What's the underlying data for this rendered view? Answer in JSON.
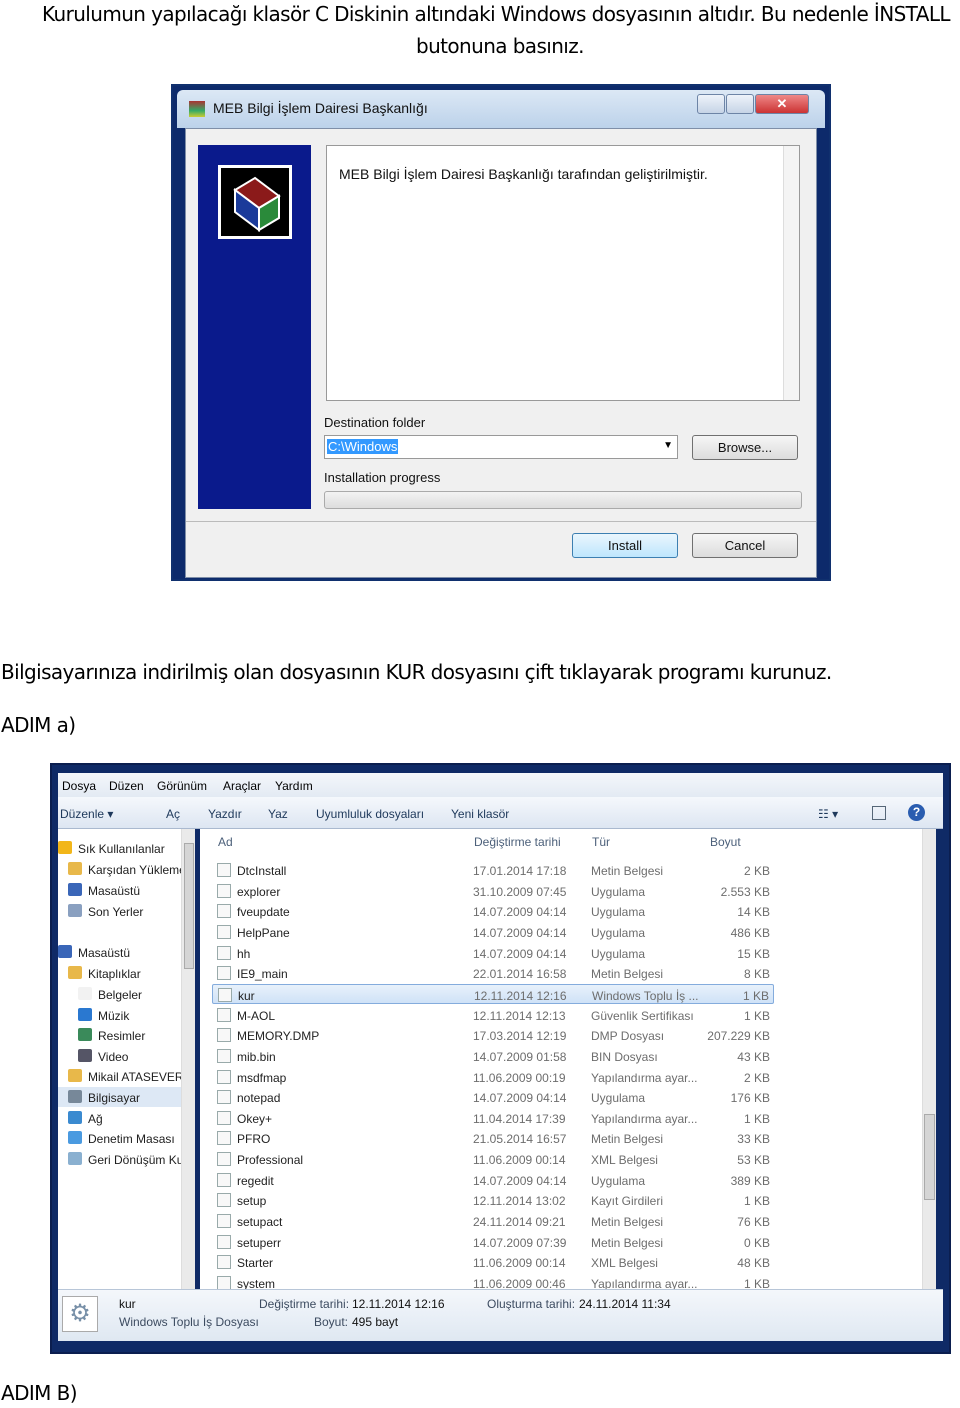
{
  "doc": {
    "intro_line1": "Kurulumun yapılacağı klasör C Diskinin altındaki Windows dosyasının altıdır. Bu nedenle İNSTALL",
    "intro_line2": "butonuna basınız.",
    "instruction": "Bilgisayarınıza indirilmiş olan dosyasının KUR dosyasını çift tıklayarak programı kurunuz.",
    "step_a": "ADIM a)",
    "step_b": "ADIM B)"
  },
  "installer": {
    "title": "MEB Bilgi İşlem Dairesi Başkanlığı",
    "message": "MEB Bilgi İşlem Dairesi Başkanlığı tarafından geliştirilmiştir.",
    "destination_label": "Destination folder",
    "destination_value": "C:\\Windows",
    "browse_label": "Browse...",
    "progress_label": "Installation progress",
    "progress": 0,
    "install_label": "Install",
    "cancel_label": "Cancel"
  },
  "explorer": {
    "menu": [
      "Dosya",
      "Düzen",
      "Görünüm",
      "Araçlar",
      "Yardım"
    ],
    "toolbar": [
      "Düzenle ▾",
      "Aç",
      "Yazdır",
      "Yaz",
      "Uyumluluk dosyaları",
      "Yeni klasör"
    ],
    "sidebar": [
      "Sık Kullanılanlar",
      "Karşıdan Yüklemeler",
      "Masaüstü",
      "Son Yerler",
      "Masaüstü",
      "Kitaplıklar",
      "Belgeler",
      "Müzik",
      "Resimler",
      "Video",
      "Mikail ATASEVER",
      "Bilgisayar",
      "Ağ",
      "Denetim Masası",
      "Geri Dönüşüm Kutusu"
    ],
    "selected_sidebar": "Bilgisayar",
    "columns": [
      "Ad",
      "Değiştirme tarihi",
      "Tür",
      "Boyut"
    ],
    "rows": [
      [
        "DtcInstall",
        "17.01.2014 17:18",
        "Metin Belgesi",
        "2 KB"
      ],
      [
        "explorer",
        "31.10.2009 07:45",
        "Uygulama",
        "2.553 KB"
      ],
      [
        "fveupdate",
        "14.07.2009 04:14",
        "Uygulama",
        "14 KB"
      ],
      [
        "HelpPane",
        "14.07.2009 04:14",
        "Uygulama",
        "486 KB"
      ],
      [
        "hh",
        "14.07.2009 04:14",
        "Uygulama",
        "15 KB"
      ],
      [
        "IE9_main",
        "22.01.2014 16:58",
        "Metin Belgesi",
        "8 KB"
      ],
      [
        "kur",
        "12.11.2014 12:16",
        "Windows Toplu İş ...",
        "1 KB"
      ],
      [
        "M-AOL",
        "12.11.2014 12:13",
        "Güvenlik Sertifikası",
        "1 KB"
      ],
      [
        "MEMORY.DMP",
        "17.03.2014 12:19",
        "DMP Dosyası",
        "207.229 KB"
      ],
      [
        "mib.bin",
        "14.07.2009 01:58",
        "BIN Dosyası",
        "43 KB"
      ],
      [
        "msdfmap",
        "11.06.2009 00:19",
        "Yapılandırma ayar...",
        "2 KB"
      ],
      [
        "notepad",
        "14.07.2009 04:14",
        "Uygulama",
        "176 KB"
      ],
      [
        "Okey+",
        "11.04.2014 17:39",
        "Yapılandırma ayar...",
        "1 KB"
      ],
      [
        "PFRO",
        "21.05.2014 16:57",
        "Metin Belgesi",
        "33 KB"
      ],
      [
        "Professional",
        "11.06.2009 00:14",
        "XML Belgesi",
        "53 KB"
      ],
      [
        "regedit",
        "14.07.2009 04:14",
        "Uygulama",
        "389 KB"
      ],
      [
        "setup",
        "12.11.2014 13:02",
        "Kayıt Girdileri",
        "1 KB"
      ],
      [
        "setupact",
        "24.11.2014 09:21",
        "Metin Belgesi",
        "76 KB"
      ],
      [
        "setuperr",
        "14.07.2009 07:39",
        "Metin Belgesi",
        "0 KB"
      ],
      [
        "Starter",
        "11.06.2009 00:14",
        "XML Belgesi",
        "48 KB"
      ],
      [
        "system",
        "11.06.2009 00:46",
        "Yapılandırma ayar...",
        "1 KB"
      ]
    ],
    "selected_row": "kur",
    "details": {
      "name": "kur",
      "type": "Windows Toplu İş Dosyası",
      "modified_label": "Değiştirme tarihi:",
      "modified": "12.11.2014 12:16",
      "size_label": "Boyut:",
      "size": "495 bayt",
      "created_label": "Oluşturma tarihi:",
      "created": "24.11.2014 11:34"
    }
  }
}
